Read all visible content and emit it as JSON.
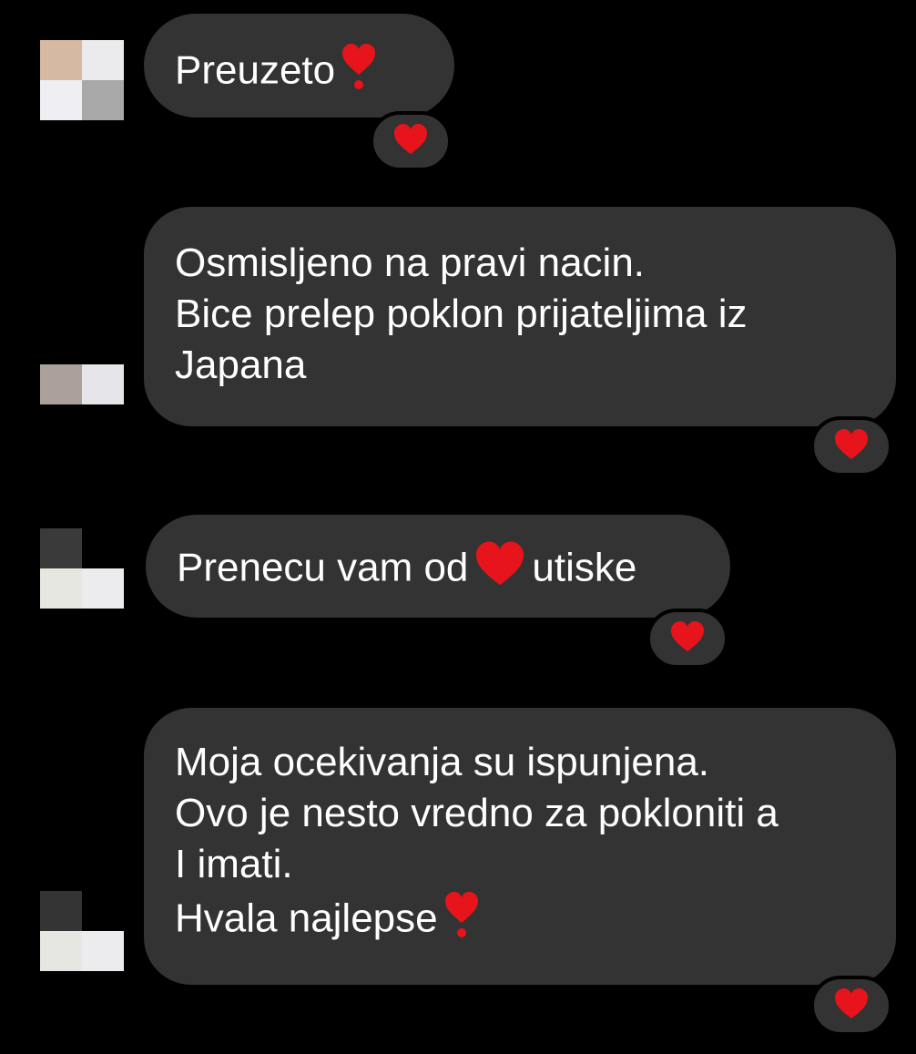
{
  "messages": [
    {
      "lines": [
        "Preuzeto"
      ],
      "trailing_emoji": "heart-exclamation",
      "reaction": "red-heart",
      "avatar_colors": [
        "#d6b9a2",
        "#ebebee",
        "#efeff3",
        "#a8a8a8"
      ]
    },
    {
      "lines": [
        "Osmisljeno na pravi nacin.",
        "Bice prelep poklon prijateljima iz",
        "Japana"
      ],
      "reaction": "red-heart",
      "avatar_colors": [
        "#aba19a",
        "#e6e6ea"
      ]
    },
    {
      "text_before": "Prenecu vam od",
      "inline_emoji": "red-heart",
      "text_after": "utiske",
      "reaction": "red-heart",
      "avatar_colors": [
        "#3a3a3a",
        "#000000",
        "#e7e7e2",
        "#ececef"
      ]
    },
    {
      "lines": [
        "Moja ocekivanja su ispunjena.",
        "Ovo je nesto vredno za pokloniti a",
        "I imati.",
        "Hvala najlepse"
      ],
      "trailing_emoji": "heart-exclamation",
      "reaction": "red-heart",
      "avatar_colors": [
        "#343434",
        "#000000",
        "#e6e6e2",
        "#ececee"
      ]
    }
  ],
  "colors": {
    "background": "#000000",
    "bubble": "#333333",
    "text": "#ffffff",
    "heart": "#e8141c"
  }
}
